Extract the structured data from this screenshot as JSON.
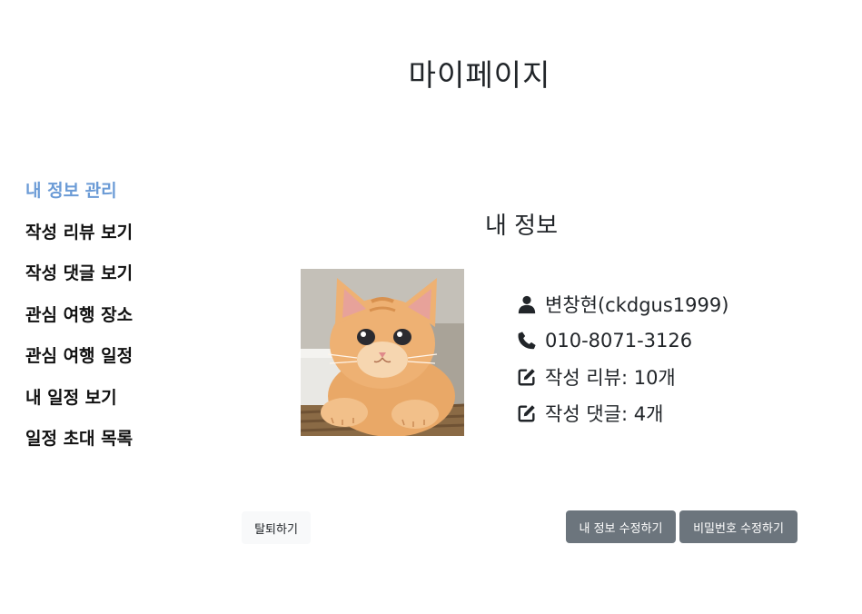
{
  "page": {
    "title": "마이페이지"
  },
  "sidebar": {
    "items": [
      {
        "label": "내 정보 관리",
        "active": true
      },
      {
        "label": "작성 리뷰 보기",
        "active": false
      },
      {
        "label": "작성 댓글 보기",
        "active": false
      },
      {
        "label": "관심 여행 장소",
        "active": false
      },
      {
        "label": "관심 여행 일정",
        "active": false
      },
      {
        "label": "내 일정 보기",
        "active": false
      },
      {
        "label": "일정 초대 목록",
        "active": false
      }
    ],
    "active_color": "#6b9bd6"
  },
  "profile": {
    "section_title": "내 정보",
    "photo_subject": "orange-kitten",
    "name_line": "변창현(ckdgus1999)",
    "phone": "010-8071-3126",
    "review_count_text": "작성 리뷰: 10개",
    "comment_count_text": "작성 댓글: 4개",
    "icons": [
      "user-icon",
      "phone-icon",
      "edit-icon",
      "edit-icon"
    ]
  },
  "actions": {
    "withdraw_label": "탈퇴하기",
    "edit_info_label": "내 정보 수정하기",
    "change_password_label": "비밀번호 수정하기",
    "secondary_color": "#6c757d",
    "light_color": "#f8f9fa"
  }
}
